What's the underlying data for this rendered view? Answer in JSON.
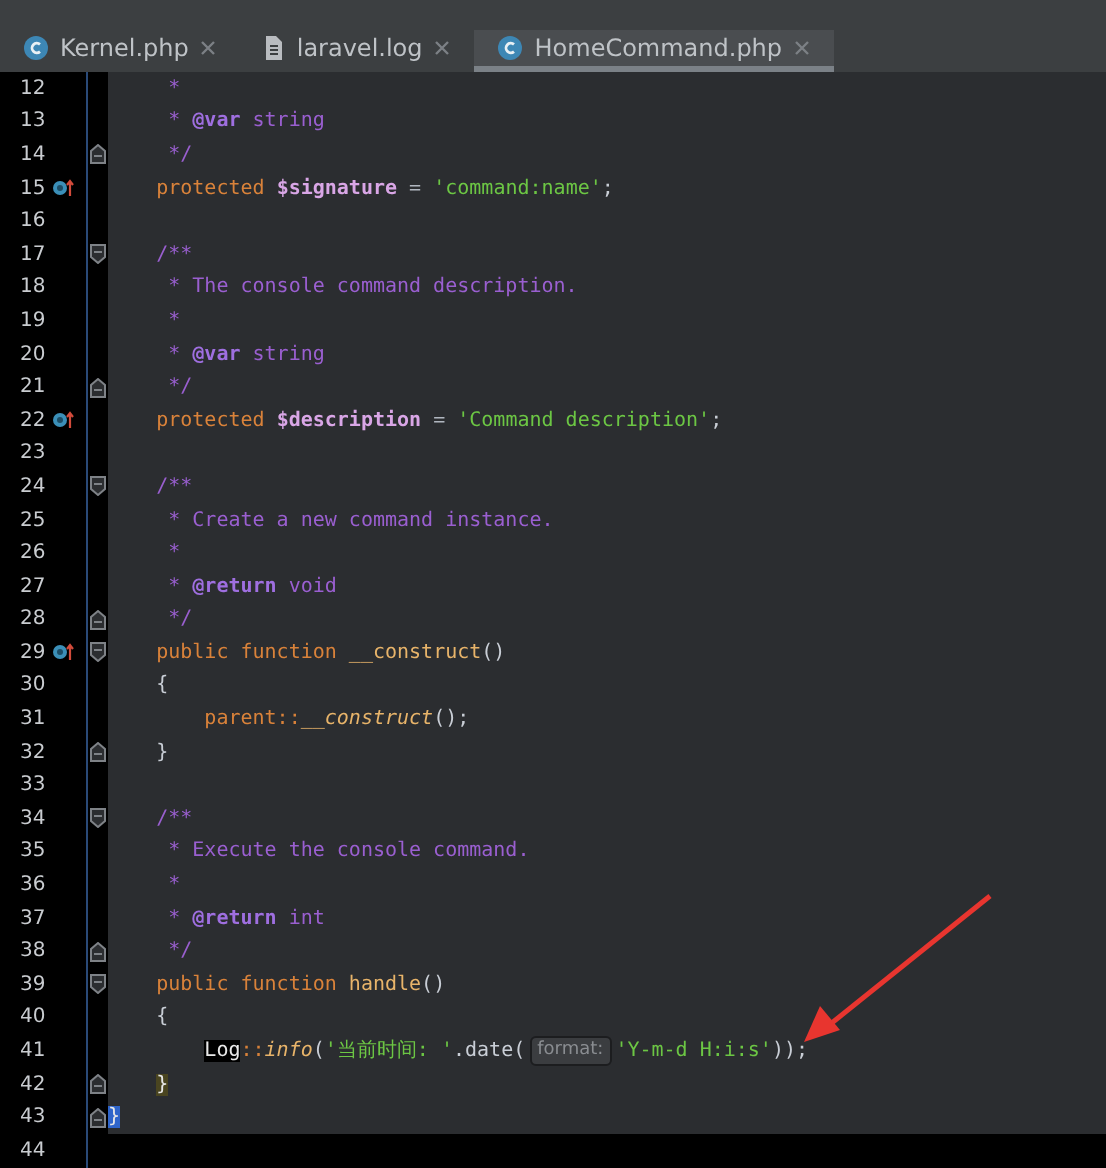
{
  "tabs": [
    {
      "kind": "class",
      "label": "Kernel.php",
      "selected": false
    },
    {
      "kind": "file",
      "label": "laravel.log",
      "selected": false
    },
    {
      "kind": "class",
      "label": "HomeCommand.php",
      "selected": true
    }
  ],
  "lines": [
    {
      "number": "12",
      "tokens": [
        {
          "kind": "comment",
          "text": "     *"
        }
      ]
    },
    {
      "number": "13",
      "tokens": [
        {
          "kind": "comment",
          "text": "     * "
        },
        {
          "kind": "doctag",
          "text": "@var"
        },
        {
          "kind": "comment",
          "text": " string"
        }
      ]
    },
    {
      "number": "14",
      "fold_end": true,
      "tokens": [
        {
          "kind": "comment",
          "text": "     */"
        }
      ]
    },
    {
      "number": "15",
      "marker": true,
      "tokens": [
        {
          "kind": "keyword",
          "text": "    protected "
        },
        {
          "kind": "variable",
          "text": "$signature"
        },
        {
          "kind": "operator",
          "text": " = "
        },
        {
          "kind": "string",
          "text": "'command:name'"
        },
        {
          "kind": "plain",
          "text": ";"
        }
      ]
    },
    {
      "number": "16"
    },
    {
      "number": "17",
      "fold_start": true,
      "tokens": [
        {
          "kind": "comment",
          "text": "    /**"
        }
      ]
    },
    {
      "number": "18",
      "tokens": [
        {
          "kind": "comment",
          "text": "     * The console command description."
        }
      ]
    },
    {
      "number": "19",
      "tokens": [
        {
          "kind": "comment",
          "text": "     *"
        }
      ]
    },
    {
      "number": "20",
      "tokens": [
        {
          "kind": "comment",
          "text": "     * "
        },
        {
          "kind": "doctag",
          "text": "@var"
        },
        {
          "kind": "comment",
          "text": " string"
        }
      ]
    },
    {
      "number": "21",
      "fold_end": true,
      "tokens": [
        {
          "kind": "comment",
          "text": "     */"
        }
      ]
    },
    {
      "number": "22",
      "marker": true,
      "tokens": [
        {
          "kind": "keyword",
          "text": "    protected "
        },
        {
          "kind": "variable",
          "text": "$description"
        },
        {
          "kind": "operator",
          "text": " = "
        },
        {
          "kind": "string",
          "text": "'Command description'"
        },
        {
          "kind": "plain",
          "text": ";"
        }
      ]
    },
    {
      "number": "23"
    },
    {
      "number": "24",
      "fold_start": true,
      "tokens": [
        {
          "kind": "comment",
          "text": "    /**"
        }
      ]
    },
    {
      "number": "25",
      "tokens": [
        {
          "kind": "comment",
          "text": "     * Create a new command instance."
        }
      ]
    },
    {
      "number": "26",
      "tokens": [
        {
          "kind": "comment",
          "text": "     *"
        }
      ]
    },
    {
      "number": "27",
      "tokens": [
        {
          "kind": "comment",
          "text": "     * "
        },
        {
          "kind": "doctag",
          "text": "@return"
        },
        {
          "kind": "comment",
          "text": " void"
        }
      ]
    },
    {
      "number": "28",
      "fold_end": true,
      "tokens": [
        {
          "kind": "comment",
          "text": "     */"
        }
      ]
    },
    {
      "number": "29",
      "marker": true,
      "fold_start": true,
      "tokens": [
        {
          "kind": "keyword",
          "text": "    public function "
        },
        {
          "kind": "function",
          "text": "__construct"
        },
        {
          "kind": "plain",
          "text": "()"
        }
      ]
    },
    {
      "number": "30",
      "tokens": [
        {
          "kind": "plain",
          "text": "    {"
        }
      ]
    },
    {
      "number": "31",
      "tokens": [
        {
          "kind": "keyword",
          "text": "        parent::"
        },
        {
          "kind": "call",
          "text": "__construct"
        },
        {
          "kind": "plain",
          "text": "();"
        }
      ]
    },
    {
      "number": "32",
      "fold_end": true,
      "tokens": [
        {
          "kind": "plain",
          "text": "    }"
        }
      ]
    },
    {
      "number": "33"
    },
    {
      "number": "34",
      "fold_start": true,
      "tokens": [
        {
          "kind": "comment",
          "text": "    /**"
        }
      ]
    },
    {
      "number": "35",
      "tokens": [
        {
          "kind": "comment",
          "text": "     * Execute the console command."
        }
      ]
    },
    {
      "number": "36",
      "tokens": [
        {
          "kind": "comment",
          "text": "     *"
        }
      ]
    },
    {
      "number": "37",
      "tokens": [
        {
          "kind": "comment",
          "text": "     * "
        },
        {
          "kind": "doctag",
          "text": "@return"
        },
        {
          "kind": "comment",
          "text": " int"
        }
      ]
    },
    {
      "number": "38",
      "fold_end": true,
      "tokens": [
        {
          "kind": "comment",
          "text": "     */"
        }
      ]
    },
    {
      "number": "39",
      "fold_start": true,
      "tokens": [
        {
          "kind": "keyword",
          "text": "    public function "
        },
        {
          "kind": "function",
          "text": "handle"
        },
        {
          "kind": "plain",
          "text": "()"
        }
      ]
    },
    {
      "number": "40",
      "tokens": [
        {
          "kind": "plain",
          "text": "    {"
        }
      ]
    },
    {
      "number": "41",
      "tokens": [
        {
          "kind": "usage",
          "text": "        Log"
        },
        {
          "kind": "keyword",
          "text": "::"
        },
        {
          "kind": "call",
          "text": "info"
        },
        {
          "kind": "plain",
          "text": "("
        },
        {
          "kind": "string",
          "text": "'当前时间: '"
        },
        {
          "kind": "plain",
          "text": ".date("
        },
        {
          "kind": "hint",
          "text": "format:"
        },
        {
          "kind": "string",
          "text": "'Y-m-d H:i:s'"
        },
        {
          "kind": "plain",
          "text": "));"
        }
      ]
    },
    {
      "number": "42",
      "fold_end": true,
      "tokens": [
        {
          "kind": "brace_match",
          "text": "    }"
        }
      ]
    },
    {
      "number": "43",
      "fold_end": true,
      "tokens": [
        {
          "kind": "brace_caret",
          "text": "}"
        }
      ]
    },
    {
      "number": "44",
      "eof": true
    }
  ]
}
